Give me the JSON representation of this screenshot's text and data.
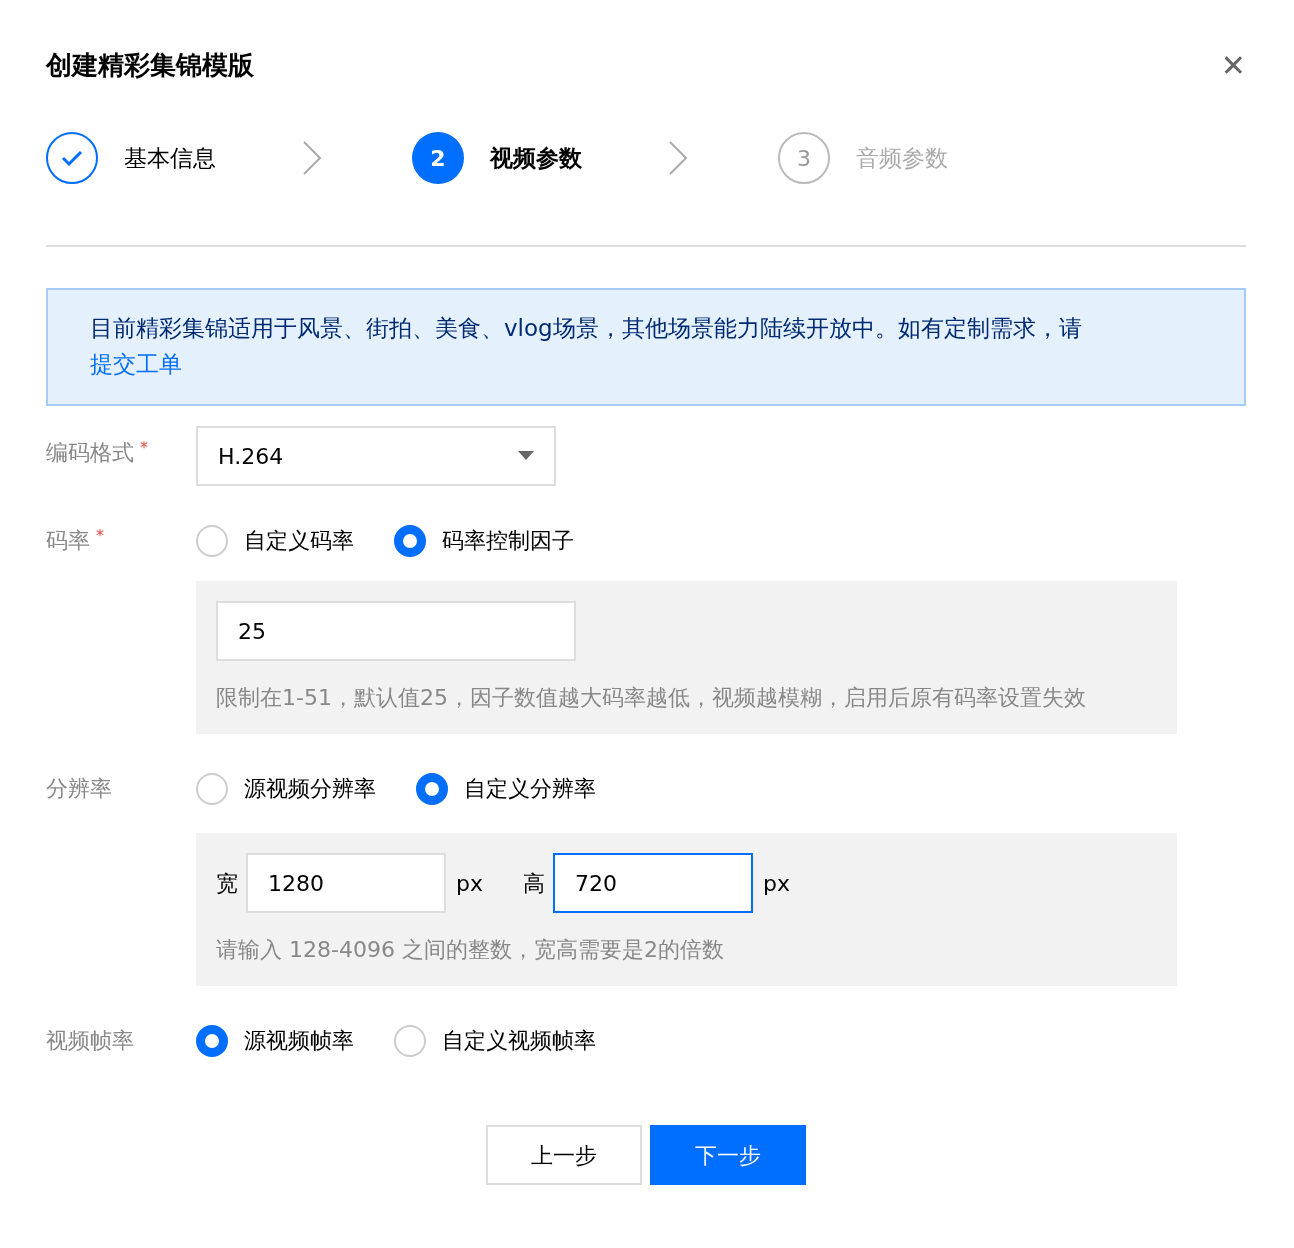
{
  "dialog": {
    "title": "创建精彩集锦模版",
    "close": "✕"
  },
  "steps": [
    {
      "label": "基本信息",
      "completed": true,
      "selected": false
    },
    {
      "label": "视频参数",
      "completed": false,
      "selected": true,
      "number": "2"
    },
    {
      "label": "音频参数",
      "completed": false,
      "selected": false,
      "number": "3"
    }
  ],
  "notice": {
    "text": "目前精彩集锦适用于风景、街拍、美食、vlog场景，其他场景能力陆续开放中。如有定制需求，请",
    "link": "提交工单"
  },
  "form": {
    "codec": {
      "label": "编码格式",
      "required_mark": "*",
      "value": "H.264"
    },
    "bitrate": {
      "label": "码率",
      "required_mark": "*",
      "options": [
        {
          "label": "自定义码率",
          "selected": false
        },
        {
          "label": "码率控制因子",
          "selected": true
        }
      ],
      "input": "25",
      "hint": "限制在1-51，默认值25，因子数值越大码率越低，视频越模糊，启用后原有码率设置失效"
    },
    "resolution": {
      "label": "分辨率",
      "options": [
        {
          "label": "源视频分辨率",
          "selected": false
        },
        {
          "label": "自定义分辨率",
          "selected": true
        }
      ],
      "fields": [
        {
          "label": "宽",
          "value": "1280",
          "unit": "px",
          "focused": false
        },
        {
          "label": "高",
          "value": "720",
          "unit": "px",
          "focused": true
        }
      ],
      "hint": "请输入 128-4096 之间的整数，宽高需要是2的倍数"
    },
    "framerate": {
      "label": "视频帧率",
      "options": [
        {
          "label": "源视频帧率",
          "selected": true
        },
        {
          "label": "自定义视频帧率",
          "selected": false
        }
      ]
    }
  },
  "buttons": [
    {
      "label": "上一步",
      "primary": false
    },
    {
      "label": "下一步",
      "primary": true
    }
  ]
}
